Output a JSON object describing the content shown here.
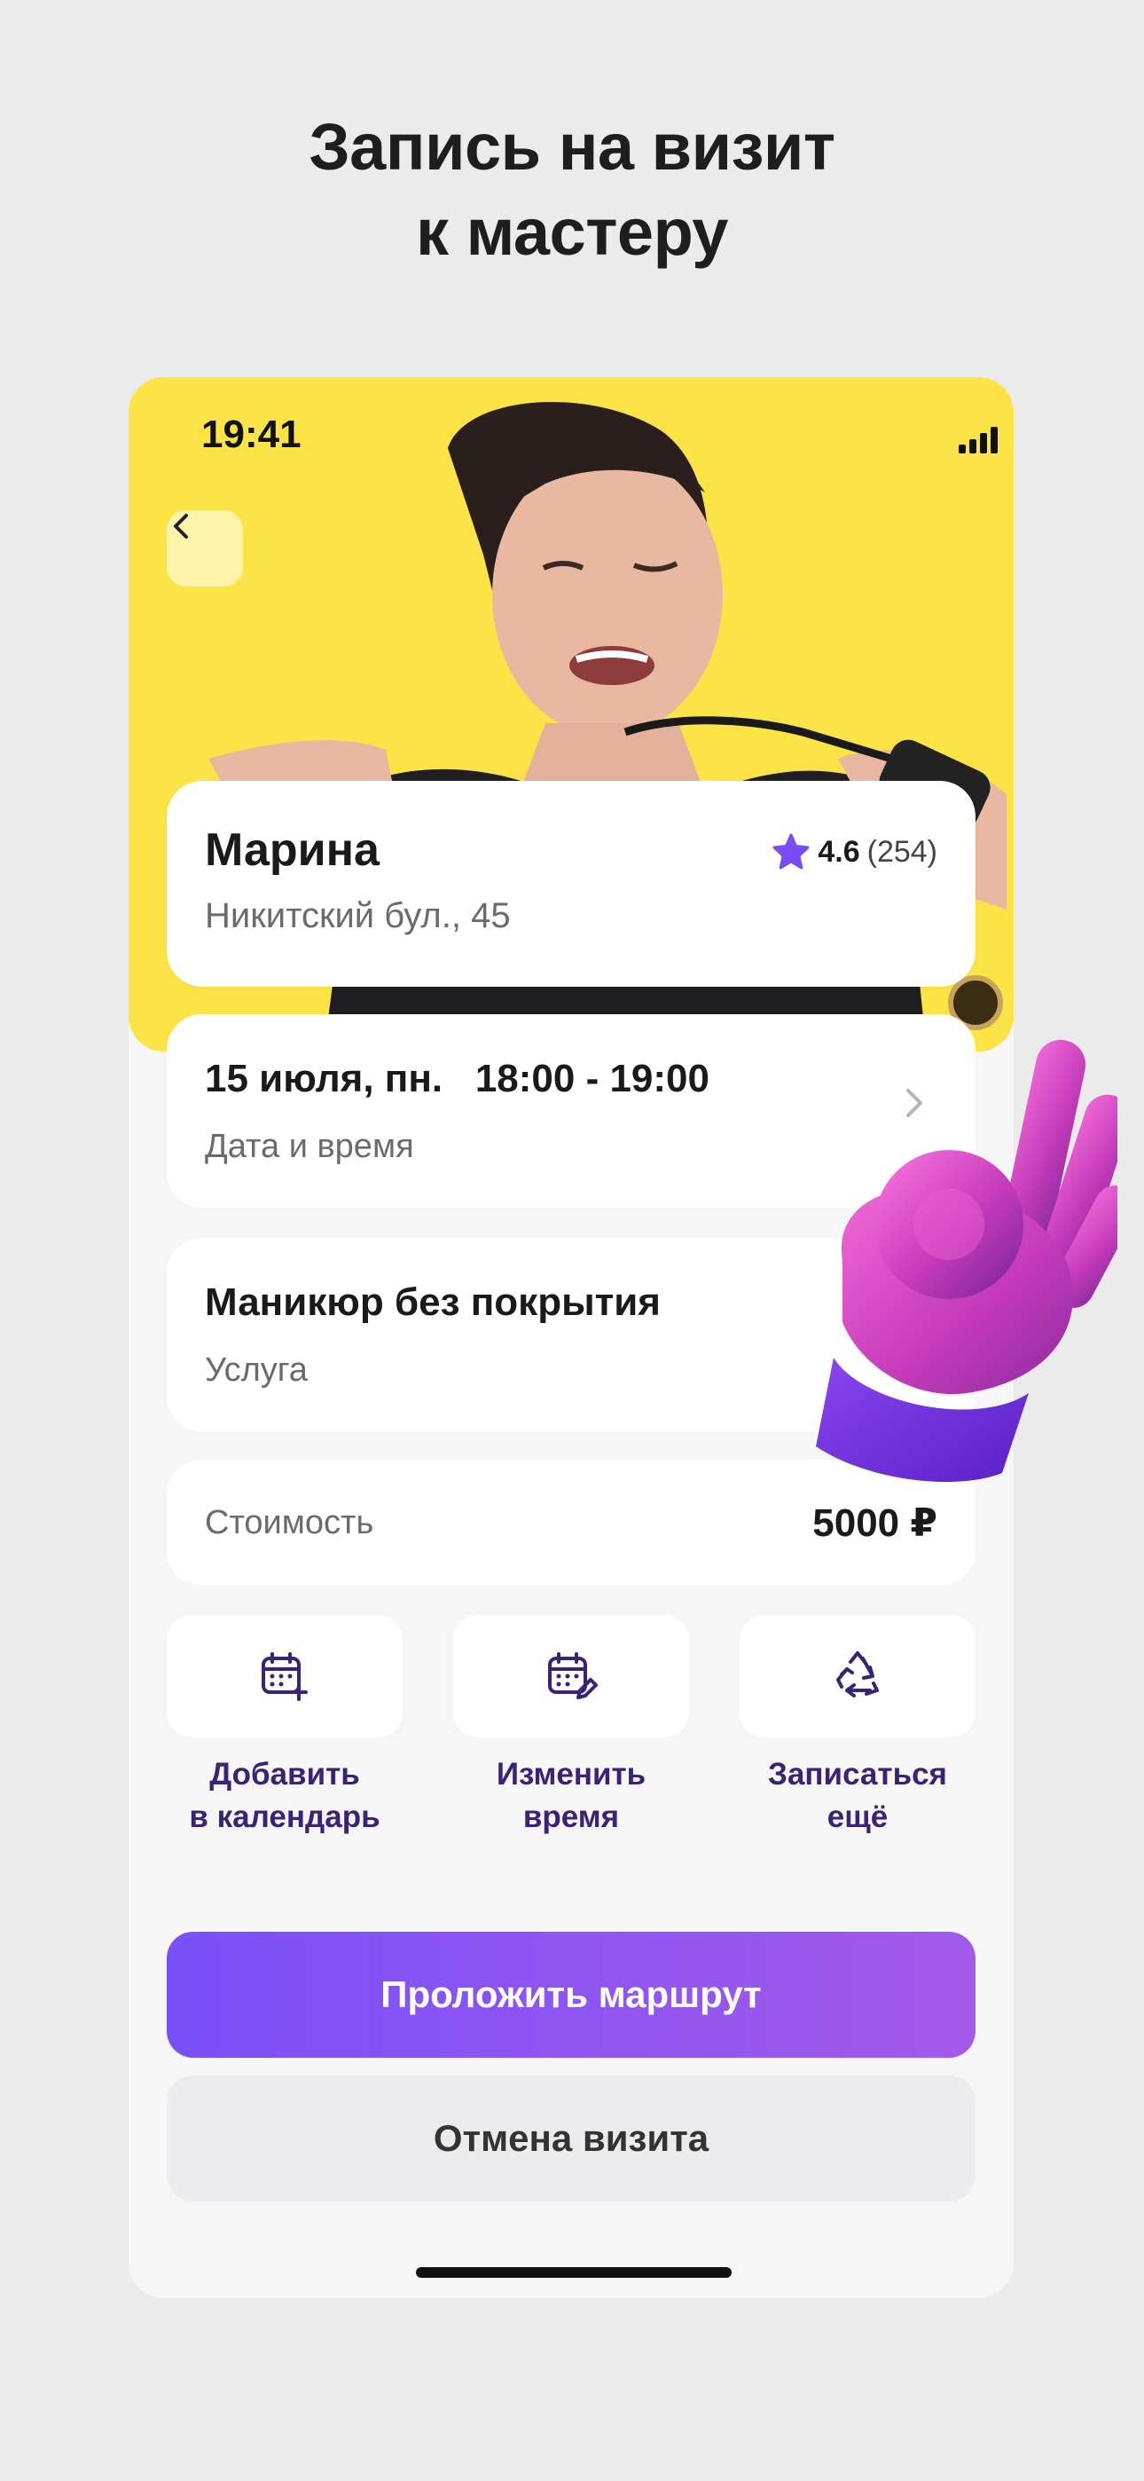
{
  "headline": {
    "line1": "Запись на визит",
    "line2": "к мастеру"
  },
  "status_bar": {
    "time": "19:41"
  },
  "master": {
    "name": "Марина",
    "address": "Никитский бул., 45",
    "rating": "4.6",
    "reviews": "(254)"
  },
  "appointment": {
    "date_time": "15 июля, пн.   18:00 - 19:00",
    "date_label": "Дата и время"
  },
  "service": {
    "name": "Маникюр без покрытия",
    "label": "Услуга"
  },
  "price": {
    "label": "Стоимость",
    "value": "5000 ₽"
  },
  "actions": [
    {
      "line1": "Добавить",
      "line2": "в календарь",
      "icon": "calendar-add-icon"
    },
    {
      "line1": "Изменить",
      "line2": "время",
      "icon": "calendar-edit-icon"
    },
    {
      "line1": "Записаться",
      "line2": "ещё",
      "icon": "recycle-icon"
    }
  ],
  "buttons": {
    "route": "Проложить маршрут",
    "cancel": "Отмена визита"
  },
  "colors": {
    "hero_bg": "#fde446",
    "accent_start": "#7950f9",
    "accent_end": "#a45ae8",
    "action_text": "#3a2276",
    "star": "#7a4cf5"
  }
}
